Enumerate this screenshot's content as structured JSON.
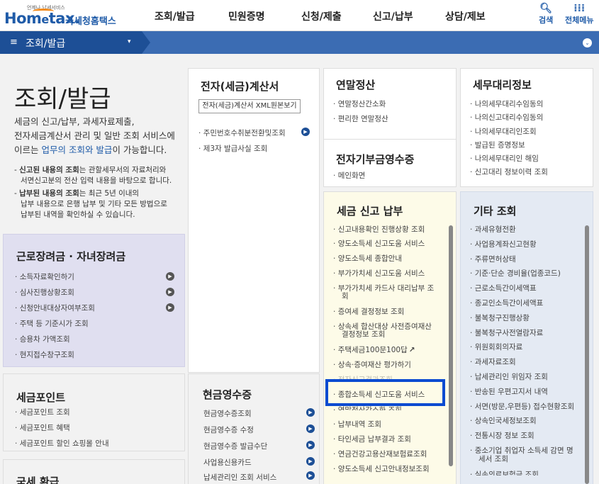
{
  "header": {
    "logo_sub": "언제나 납세서비스",
    "logo_main": "Hom",
    "logo_e": "e",
    "logo_tail": "tax.",
    "logo_kr": "국세청홈택스",
    "nav": [
      "조회/발급",
      "민원증명",
      "신청/제출",
      "신고/납부",
      "상담/제보"
    ],
    "search_label": "검색",
    "allmenu_label": "전체메뉴"
  },
  "navbar": {
    "menu_glyph": "≡",
    "title": "조회/발급",
    "dropdown_glyph": "▾",
    "toggle_glyph": "⌄"
  },
  "intro": {
    "title": "조회/발급",
    "desc_1": "세금의 신고/납부, 과세자료제출,",
    "desc_2": "전자세금계산서 관리 및 일반 조회 서비스에",
    "desc_3a": "이르는 ",
    "desc_3b": "업무의 조회와 발급",
    "desc_3c": "이 가능합니다.",
    "note1_a": "신고된 내용의 조회",
    "note1_b": "는 관할세무서의 자료처리와",
    "note1_c": "서면신고분의 전산 입력 내용을 바탕으로 합니다.",
    "note2_a": "납부된 내용의 조회",
    "note2_b": "는 최근 5년 이내의",
    "note2_c": "납부 내용으로 은행 납부 및 기타 모든 방법으로",
    "note2_d": "납부된 내역을 확인하실 수 있습니다."
  },
  "labor": {
    "title": "근로장려금 · 자녀장려금",
    "items": [
      "소득자료확인하기",
      "심사진행상황조회",
      "신청안내대상자여부조회",
      "주택 등 기준시가 조회",
      "승용차 가액조회",
      "현지접수창구조회"
    ]
  },
  "points": {
    "title": "세금포인트",
    "items": [
      "세금포인트 조회",
      "세금포인트 혜택",
      "세금포인트 할인 쇼핑몰 안내"
    ]
  },
  "refund": {
    "title": "국세 환급"
  },
  "einvoice": {
    "title": "전자(세금)계산서",
    "button": "전자(세금)계산서 XML원본보기",
    "items": [
      "주민번호수취분전환및조회",
      "제3자 발급사실 조회"
    ]
  },
  "cash": {
    "title": "현금영수증",
    "items": [
      "현금영수증조회",
      "현금영수증 수정",
      "현금영수증 발급수단",
      "사업용신용카드",
      "납세관리인 조회 서비스"
    ]
  },
  "yearend": {
    "title": "연말정산",
    "items": [
      "연말정산간소화",
      "편리한 연말정산"
    ]
  },
  "donation": {
    "title": "전자기부금영수증",
    "items": [
      "메인화면"
    ]
  },
  "tax": {
    "title": "세금 신고 납부",
    "items": [
      "신고내용확인 진행상황 조회",
      "양도소득세 신고도움 서비스",
      "양도소득세 종합안내",
      "부가가치세 신고도움 서비스",
      "부가가치세 카드사 대리납부 조",
      "회",
      "증여세 결정정보 조회",
      "상속세 합산대상 사전증여재산",
      "결정정보 조회",
      "주택세금100문100답",
      "상속·증여재산 평가하기",
      "전자신고결과조회",
      "종합소득세 신고도움 서비스",
      "연말정산간소화 조회",
      "납부내역 조회",
      "타인세금 납부결과 조회",
      "연금건강고용산재보험료조회",
      "양도소득세 신고안내정보조회"
    ],
    "external_glyph": "↗"
  },
  "agent": {
    "title": "세무대리정보",
    "items": [
      "나의세무대리수임동의",
      "나의신고대리수임동의",
      "나의세무대리인조회",
      "발급된 증명정보",
      "나의세무대리인 해임",
      "신고대리 정보이력 조회"
    ]
  },
  "etc": {
    "title": "기타 조회",
    "items": [
      "과세유형전환",
      "사업용계좌신고현황",
      "주류면허상태",
      "기준·단순 경비율(업종코드)",
      "근로소득간이세액표",
      "종교인소득간이세액표",
      "불복청구진행상황",
      "불복청구사전열람자료",
      "위원회회의자료",
      "과세자료조회",
      "납세관리인 위임자 조회",
      "반송된 우편고지서 내역",
      "서면(방문,우편등) 접수현황조회",
      "상속인국세정보조회",
      "전통시장 정보 조회",
      "중소기업 취업자 소득세 감면 명",
      "세서 조회",
      "실손의료보험금 조회"
    ]
  },
  "colors": {
    "brand": "#1f5ba8",
    "navbar": "#3b6cb3",
    "labor_bg": "#e0dff0",
    "tax_bg": "#fdfbe8",
    "etc_bg": "#e4eaf3",
    "highlight": "#0b4bd1"
  }
}
